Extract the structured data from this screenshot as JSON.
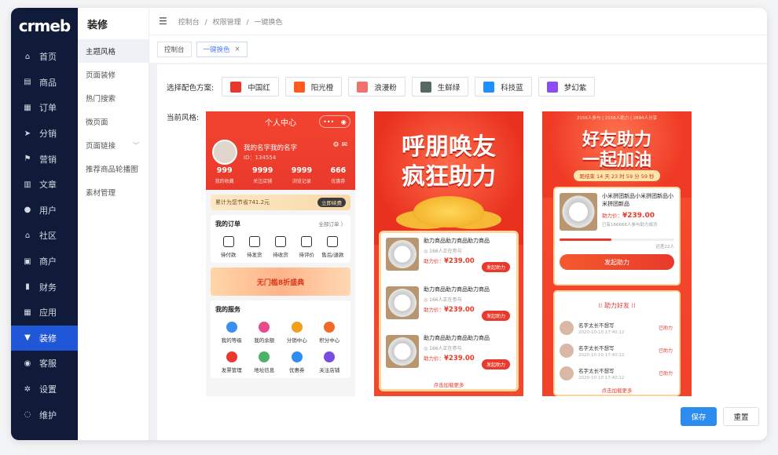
{
  "brand": {
    "logo": "crmeb"
  },
  "nav": {
    "items": [
      {
        "label": "首页",
        "icon": "home-icon"
      },
      {
        "label": "商品",
        "icon": "shop-icon"
      },
      {
        "label": "订单",
        "icon": "order-icon"
      },
      {
        "label": "分销",
        "icon": "send-icon"
      },
      {
        "label": "营销",
        "icon": "flag-icon"
      },
      {
        "label": "文章",
        "icon": "article-icon"
      },
      {
        "label": "用户",
        "icon": "user-icon"
      },
      {
        "label": "社区",
        "icon": "community-icon"
      },
      {
        "label": "商户",
        "icon": "merchant-icon"
      },
      {
        "label": "财务",
        "icon": "chart-icon"
      },
      {
        "label": "应用",
        "icon": "grid-icon"
      },
      {
        "label": "装修",
        "icon": "decorate-icon"
      },
      {
        "label": "客服",
        "icon": "service-icon"
      },
      {
        "label": "设置",
        "icon": "gear-icon"
      },
      {
        "label": "维护",
        "icon": "maintain-icon"
      }
    ],
    "active_index": 11
  },
  "sub": {
    "title": "装修",
    "items": [
      {
        "label": "主题风格"
      },
      {
        "label": "页面装修"
      },
      {
        "label": "热门搜索"
      },
      {
        "label": "微页面"
      },
      {
        "label": "页面链接"
      },
      {
        "label": "推荐商品轮播图"
      },
      {
        "label": "素材管理"
      }
    ]
  },
  "breadcrumb": [
    "控制台",
    "/",
    "权限管理",
    "/",
    "一键换色"
  ],
  "tabs": [
    {
      "label": "控制台"
    },
    {
      "label": "一键换色"
    }
  ],
  "scheme": {
    "label": "选择配色方案:",
    "options": [
      {
        "label": "中国红",
        "color": "#e8392c"
      },
      {
        "label": "阳光橙",
        "color": "#ff5a1f"
      },
      {
        "label": "浪漫粉",
        "color": "#f0726f"
      },
      {
        "label": "生鲜绿",
        "color": "#566a64"
      },
      {
        "label": "科技蓝",
        "color": "#1e90ff"
      },
      {
        "label": "梦幻紫",
        "color": "#8a4df0"
      }
    ]
  },
  "current_label": "当前风格:",
  "preview1": {
    "header": "个人中心",
    "user_name": "我的名字我的名字",
    "user_id": "ID：134554",
    "stats": [
      {
        "value": "999",
        "label": "我的收藏"
      },
      {
        "value": "9999",
        "label": "关注店铺"
      },
      {
        "value": "9999",
        "label": "浏览记录"
      },
      {
        "value": "666",
        "label": "优惠券"
      }
    ],
    "save_text": "累计为您节省741.2元",
    "save_btn": "立即续费",
    "orders_title": "我的订单",
    "orders_all": "全部订单 〉",
    "orders": [
      "待付款",
      "待发货",
      "待收货",
      "待评价",
      "售后/退款"
    ],
    "banner": "无门槛8折盛典",
    "services_title": "我的服务",
    "services": [
      "我的等级",
      "我的余额",
      "分销中心",
      "积分中心",
      "发票管理",
      "地址信息",
      "优惠券",
      "关注店铺"
    ],
    "service_colors": [
      "#3c8ef0",
      "#e84a8a",
      "#f0a01b",
      "#f06a2a",
      "#e8392c",
      "#4ab26a",
      "#2d8cf0",
      "#7a4de0"
    ]
  },
  "preview2": {
    "title_line1": "呼朋唤友",
    "title_line2": "疯狂助力",
    "items": [
      {
        "title": "助力商品助力商品助力商品",
        "sub": "166人正在参与",
        "price_label": "助力价：",
        "price": "¥239.00",
        "btn": "发起助力"
      },
      {
        "title": "助力商品助力商品助力商品",
        "sub": "166人正在参与",
        "price_label": "助力价：",
        "price": "¥239.00",
        "btn": "发起助力"
      },
      {
        "title": "助力商品助力商品助力商品",
        "sub": "166人正在参与",
        "price_label": "助力价：",
        "price": "¥239.00",
        "btn": "发起助力"
      }
    ],
    "more": "点击加载更多"
  },
  "preview3": {
    "top_info": "2156人参与 | 2156人助力 | 2894人分享",
    "title_line1": "好友助力",
    "title_line2": "一起加油",
    "timer": "距结束 14 天 23 时 59 分 59 秒",
    "product_title": "小米拼团新品小米拼团新品小米拼团新品",
    "price_label": "助力价：",
    "price": "¥239.00",
    "sub": "已有166666人参与助力成功",
    "helped": "还差22人",
    "progress": 0.45,
    "btn": "发起助力",
    "friends_title": "助力好友",
    "friends": [
      {
        "name": "名字太长不想写",
        "time": "2020-10-10 17:40:12",
        "action": "已助力"
      },
      {
        "name": "名字太长不想写",
        "time": "2020-10-10 17:40:12",
        "action": "已助力"
      },
      {
        "name": "名字太长不想写",
        "time": "2020-10-10 17:40:12",
        "action": "已助力"
      }
    ],
    "more": "点击加载更多"
  },
  "actions": {
    "save": "保存",
    "reset": "重置"
  }
}
